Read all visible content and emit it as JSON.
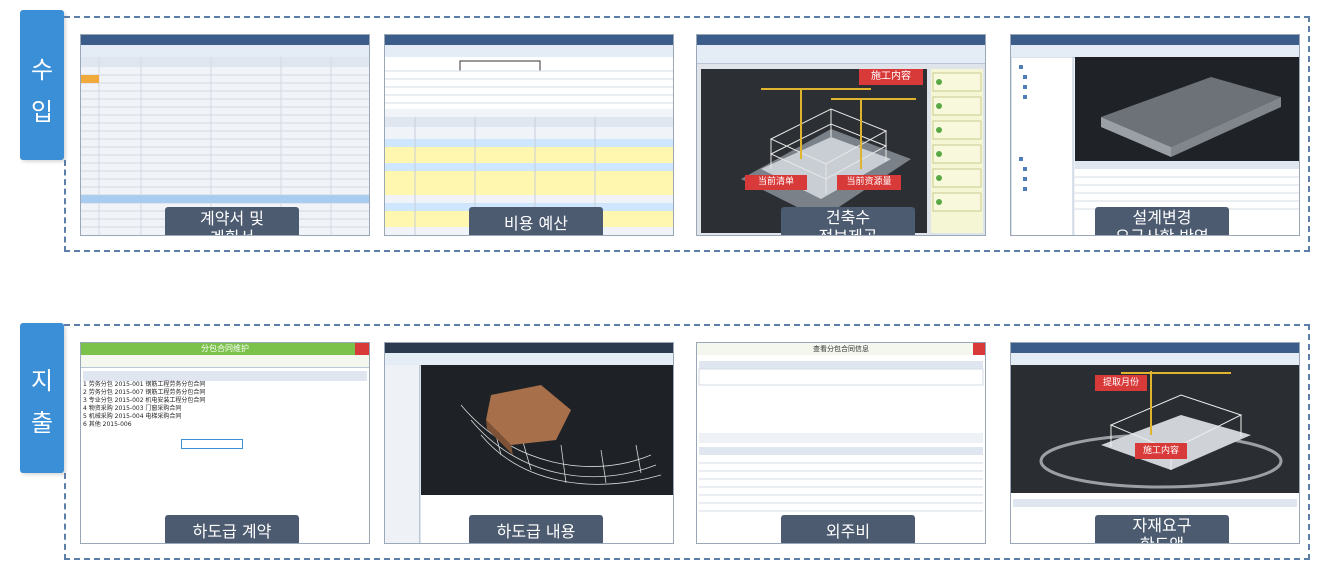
{
  "income": {
    "side_label": "수\n입",
    "side_chars": [
      "수",
      "입"
    ],
    "items": [
      {
        "caption": "계약서 및\n계획서"
      },
      {
        "caption": "비용 예산"
      },
      {
        "caption": "건축수\n정보제공"
      },
      {
        "caption": "설계변경\n요구사항 반영"
      }
    ]
  },
  "expense": {
    "side_chars": [
      "지",
      "출"
    ],
    "items": [
      {
        "caption": "하도급 계약"
      },
      {
        "caption": "하도급 내용"
      },
      {
        "caption": "외주비"
      },
      {
        "caption": "자재요구\n한도액"
      }
    ]
  },
  "screens": {
    "budget_tag_left": "当前清单",
    "budget_tag_right": "当前资源量",
    "construction_tag": "施工内容",
    "subcontract_title": "分包合同维护",
    "outsourcing_title": "查看分包合同信息",
    "month_tag": "提取月份",
    "expense_construction_tag": "施工内容",
    "accent_red": "#d83a3a",
    "caption_bg": "#4c5b70",
    "tab_blue": "#3b8fd6",
    "subcontract_rows": [
      "1  劳务分包   2015-001   钢筋工程劳务分包合同",
      "2  劳务分包   2015-007   钢筋工程劳务分包合同",
      "3  专业分包   2015-002   机电安装工程分包合同",
      "4  物资采购   2015-003   门窗采购合同",
      "5  机械采购   2015-004   电梯采购合同",
      "6  其他       2015-006"
    ]
  }
}
